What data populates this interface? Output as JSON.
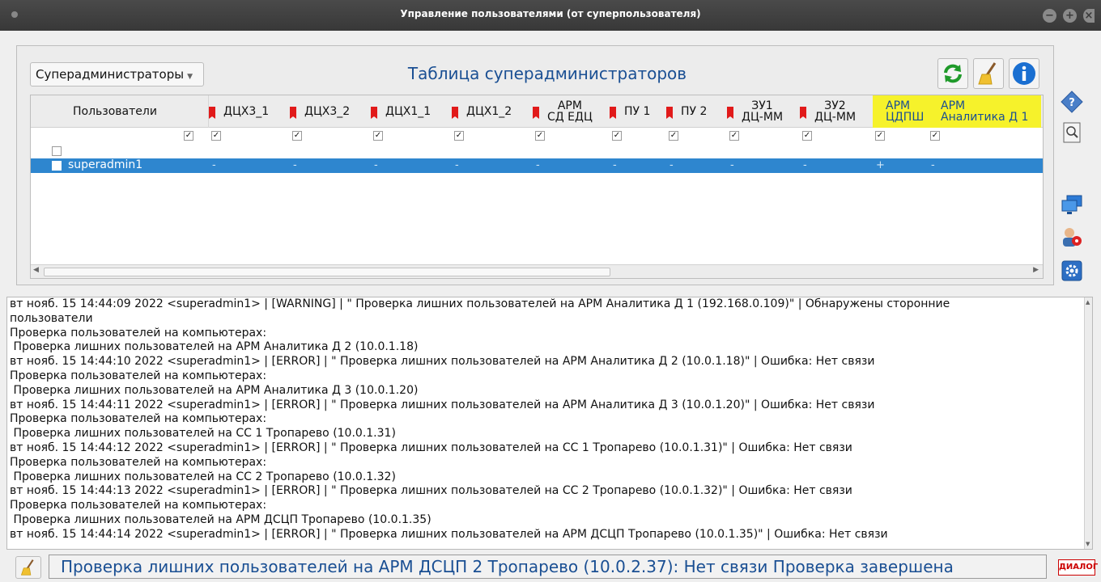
{
  "window": {
    "title": "Управление пользователями (от суперпользователя)"
  },
  "toolbar": {
    "combo_value": "Суперадминистраторы",
    "table_title": "Таблица суперадминистраторов"
  },
  "table": {
    "users_header": "Пользователи",
    "columns": [
      {
        "label": "ДЦХ3_1",
        "flag": true
      },
      {
        "label": "ДЦХ3_2",
        "flag": true
      },
      {
        "label": "ДЦХ1_1",
        "flag": true
      },
      {
        "label": "ДЦХ1_2",
        "flag": true
      },
      {
        "label": "АРМ\nСД ЕДЦ",
        "flag": true
      },
      {
        "label": "ПУ 1",
        "flag": true
      },
      {
        "label": "ПУ 2",
        "flag": true
      },
      {
        "label": "ЗУ1\nДЦ-ММ",
        "flag": true
      },
      {
        "label": "ЗУ2\nДЦ-ММ",
        "flag": true
      },
      {
        "label": "АРМ\nЦДПШ",
        "flag": false,
        "highlight": "#f6f22b"
      },
      {
        "label": "АРМ\nАналитика Д 1",
        "flag": false,
        "highlight": "#f6f22b"
      }
    ],
    "checkmark": "✓",
    "rows": [
      {
        "name": "superadmin1",
        "values": [
          "-",
          "-",
          "-",
          "-",
          "-",
          "-",
          "-",
          "-",
          "-",
          "+",
          "-"
        ],
        "selected": true
      }
    ]
  },
  "log": {
    "lines": [
      "вт нояб. 15 14:44:09 2022 <superadmin1> | [WARNING] | \" Проверка лишних пользователей на АРМ Аналитика Д 1 (192.168.0.109)\" | Обнаружены сторонние",
      "пользователи",
      "Проверка пользователей на компьютерах:",
      " Проверка лишних пользователей на АРМ Аналитика Д 2 (10.0.1.18)",
      "вт нояб. 15 14:44:10 2022 <superadmin1> | [ERROR] | \" Проверка лишних пользователей на АРМ Аналитика Д 2 (10.0.1.18)\" | Ошибка: Нет связи",
      "Проверка пользователей на компьютерах:",
      " Проверка лишних пользователей на АРМ Аналитика Д 3 (10.0.1.20)",
      "вт нояб. 15 14:44:11 2022 <superadmin1> | [ERROR] | \" Проверка лишних пользователей на АРМ Аналитика Д 3 (10.0.1.20)\" | Ошибка: Нет связи",
      "Проверка пользователей на компьютерах:",
      " Проверка лишних пользователей на СС 1 Тропарево (10.0.1.31)",
      "вт нояб. 15 14:44:12 2022 <superadmin1> | [ERROR] | \" Проверка лишних пользователей на СС 1 Тропарево (10.0.1.31)\" | Ошибка: Нет связи",
      "Проверка пользователей на компьютерах:",
      " Проверка лишних пользователей на СС 2 Тропарево (10.0.1.32)",
      "вт нояб. 15 14:44:13 2022 <superadmin1> | [ERROR] | \" Проверка лишних пользователей на СС 2 Тропарево (10.0.1.32)\" | Ошибка: Нет связи",
      "Проверка пользователей на компьютерах:",
      " Проверка лишних пользователей на АРМ ДСЦП Тропарево (10.0.1.35)",
      "вт нояб. 15 14:44:14 2022 <superadmin1> | [ERROR] | \" Проверка лишних пользователей на АРМ ДСЦП Тропарево (10.0.1.35)\" | Ошибка: Нет связи"
    ]
  },
  "status": {
    "message": "Проверка лишних пользователей на АРМ ДСЦП 2 Тропарево (10.0.2.37): Нет связи   Проверка завершена",
    "dialog_label": "ДИАЛОГ"
  },
  "colors": {
    "accent": "#1a4f93",
    "selection": "#2e86cf",
    "highlight": "#f6f22b",
    "flag": "#e11a1a"
  }
}
